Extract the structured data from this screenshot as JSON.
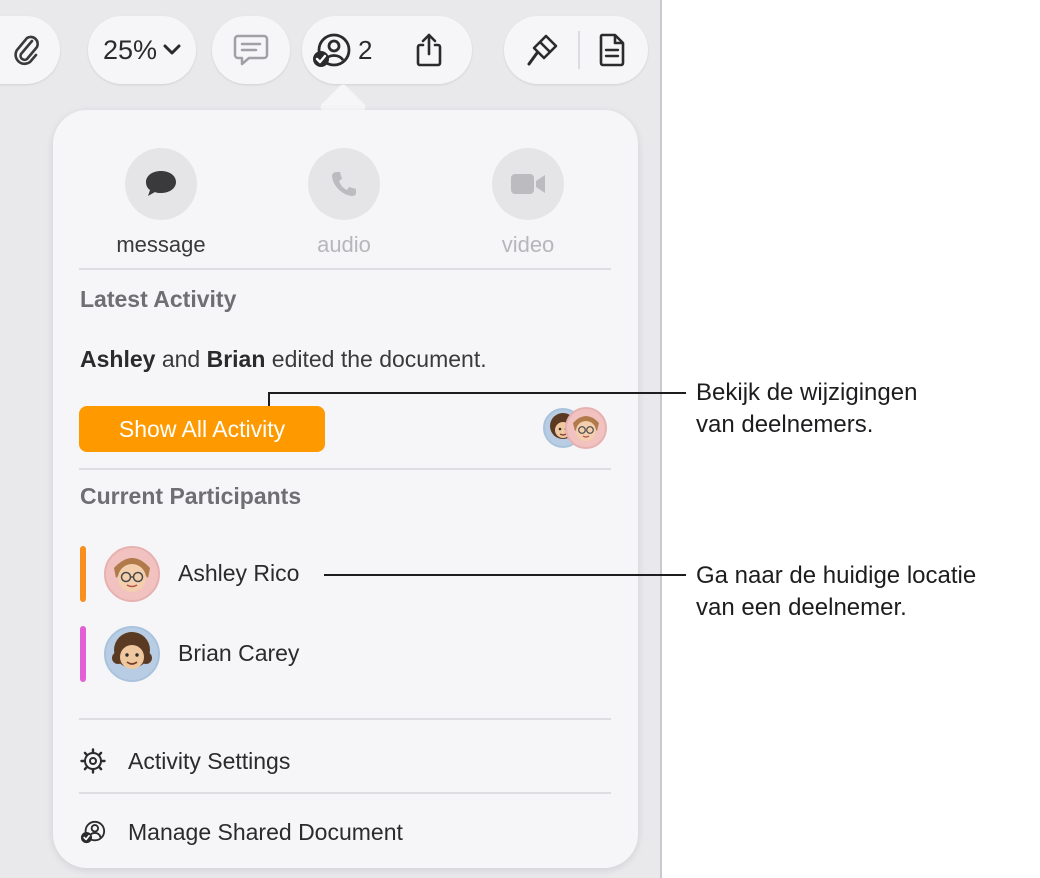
{
  "toolbar": {
    "zoom": "25%",
    "collaborator_count": "2"
  },
  "contacts": {
    "message": "message",
    "audio": "audio",
    "video": "video"
  },
  "latest_activity": {
    "title": "Latest Activity",
    "name1": "Ashley",
    "conj": " and ",
    "name2": "Brian",
    "rest": " edited the document.",
    "button": "Show All Activity"
  },
  "participants": {
    "title": "Current Participants",
    "items": [
      {
        "name": "Ashley Rico",
        "color": "#f7901e"
      },
      {
        "name": "Brian Carey",
        "color": "#e35fd5"
      }
    ]
  },
  "menu": {
    "activity_settings": "Activity Settings",
    "manage_shared": "Manage Shared Document"
  },
  "callouts": {
    "first_line1": "Bekijk de wijzigingen",
    "first_line2": "van deelnemers.",
    "second_line1": "Ga naar de huidige locatie",
    "second_line2": "van een deelnemer."
  },
  "colors": {
    "accent": "#fe9a00",
    "panel": "#f6f6f8"
  }
}
